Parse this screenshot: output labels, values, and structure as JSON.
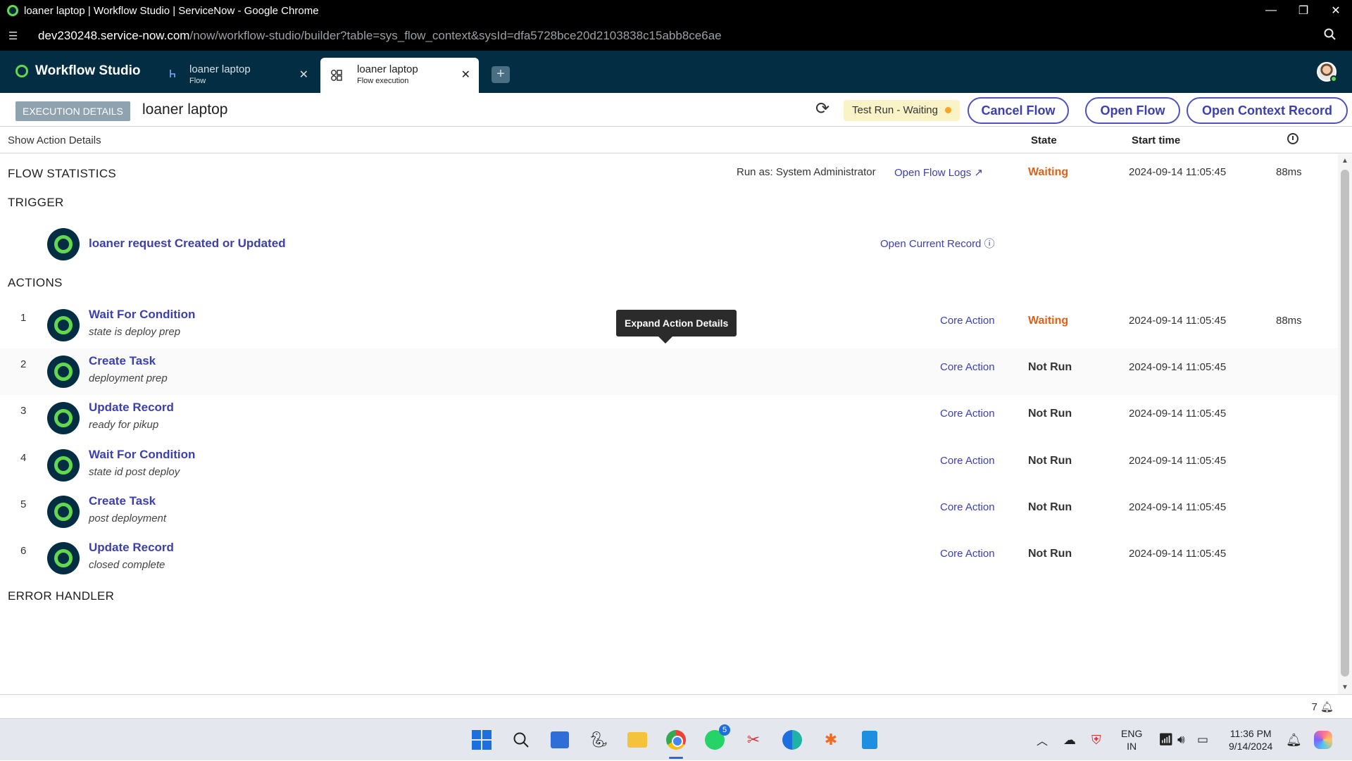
{
  "window": {
    "title": "loaner laptop | Workflow Studio | ServiceNow - Google Chrome",
    "controls": {
      "minimize": "—",
      "restore": "❐",
      "close": "✕"
    }
  },
  "address_bar": {
    "host": "dev230248.service-now.com",
    "path": "/now/workflow-studio/builder?table=sys_flow_context&sysId=dfa5728bce20d2103838c15abb8ce6ae"
  },
  "app_header": {
    "brand": "Workflow Studio",
    "tabs": [
      {
        "title": "loaner laptop",
        "subtitle": "Flow",
        "icon": "flow-icon",
        "active": false
      },
      {
        "title": "loaner laptop",
        "subtitle": "Flow execution",
        "icon": "flow-execution-icon",
        "active": true
      }
    ],
    "new_tab": "+"
  },
  "toolbar": {
    "badge": "EXECUTION DETAILS",
    "title": "loaner laptop",
    "status": "Test Run - Waiting",
    "cancel_label": "Cancel Flow",
    "open_flow_label": "Open Flow",
    "open_context_label": "Open Context Record"
  },
  "columns": {
    "show_details": "Show Action Details",
    "state": "State",
    "start_time": "Start time"
  },
  "flow_statistics": {
    "heading": "FLOW STATISTICS",
    "run_as": "Run as: System Administrator",
    "logs_link": "Open Flow Logs",
    "state": "Waiting",
    "start_time": "2024-09-14 11:05:45",
    "duration": "88ms"
  },
  "trigger": {
    "heading": "TRIGGER",
    "label": "loaner request Created or Updated",
    "open_current": "Open Current Record"
  },
  "actions": {
    "heading": "ACTIONS",
    "items": [
      {
        "num": "1",
        "name": "Wait For Condition",
        "desc": "state is deploy prep",
        "type": "Core Action",
        "state": "Waiting",
        "start": "2024-09-14 11:05:45",
        "duration": "88ms"
      },
      {
        "num": "2",
        "name": "Create Task",
        "desc": "deployment prep",
        "type": "Core Action",
        "state": "Not Run",
        "start": "2024-09-14 11:05:45",
        "duration": ""
      },
      {
        "num": "3",
        "name": "Update Record",
        "desc": "ready for pikup",
        "type": "Core Action",
        "state": "Not Run",
        "start": "2024-09-14 11:05:45",
        "duration": ""
      },
      {
        "num": "4",
        "name": "Wait For Condition",
        "desc": "state id post deploy",
        "type": "Core Action",
        "state": "Not Run",
        "start": "2024-09-14 11:05:45",
        "duration": ""
      },
      {
        "num": "5",
        "name": "Create Task",
        "desc": "post deployment",
        "type": "Core Action",
        "state": "Not Run",
        "start": "2024-09-14 11:05:45",
        "duration": ""
      },
      {
        "num": "6",
        "name": "Update Record",
        "desc": "closed complete",
        "type": "Core Action",
        "state": "Not Run",
        "start": "2024-09-14 11:05:45",
        "duration": ""
      }
    ]
  },
  "error_handler": {
    "heading": "ERROR HANDLER"
  },
  "tooltip": "Expand Action Details",
  "footer": {
    "notifications": "7"
  },
  "taskbar": {
    "whatsapp_badge": "5",
    "lang": "ENG",
    "region": "IN",
    "time": "11:36 PM",
    "date": "9/14/2024"
  },
  "colors": {
    "header_bg": "#032d42",
    "accent_green": "#62d84e",
    "link": "#3c3fb0",
    "waiting": "#d9631d",
    "status_pill_bg": "#fbf3c8"
  }
}
